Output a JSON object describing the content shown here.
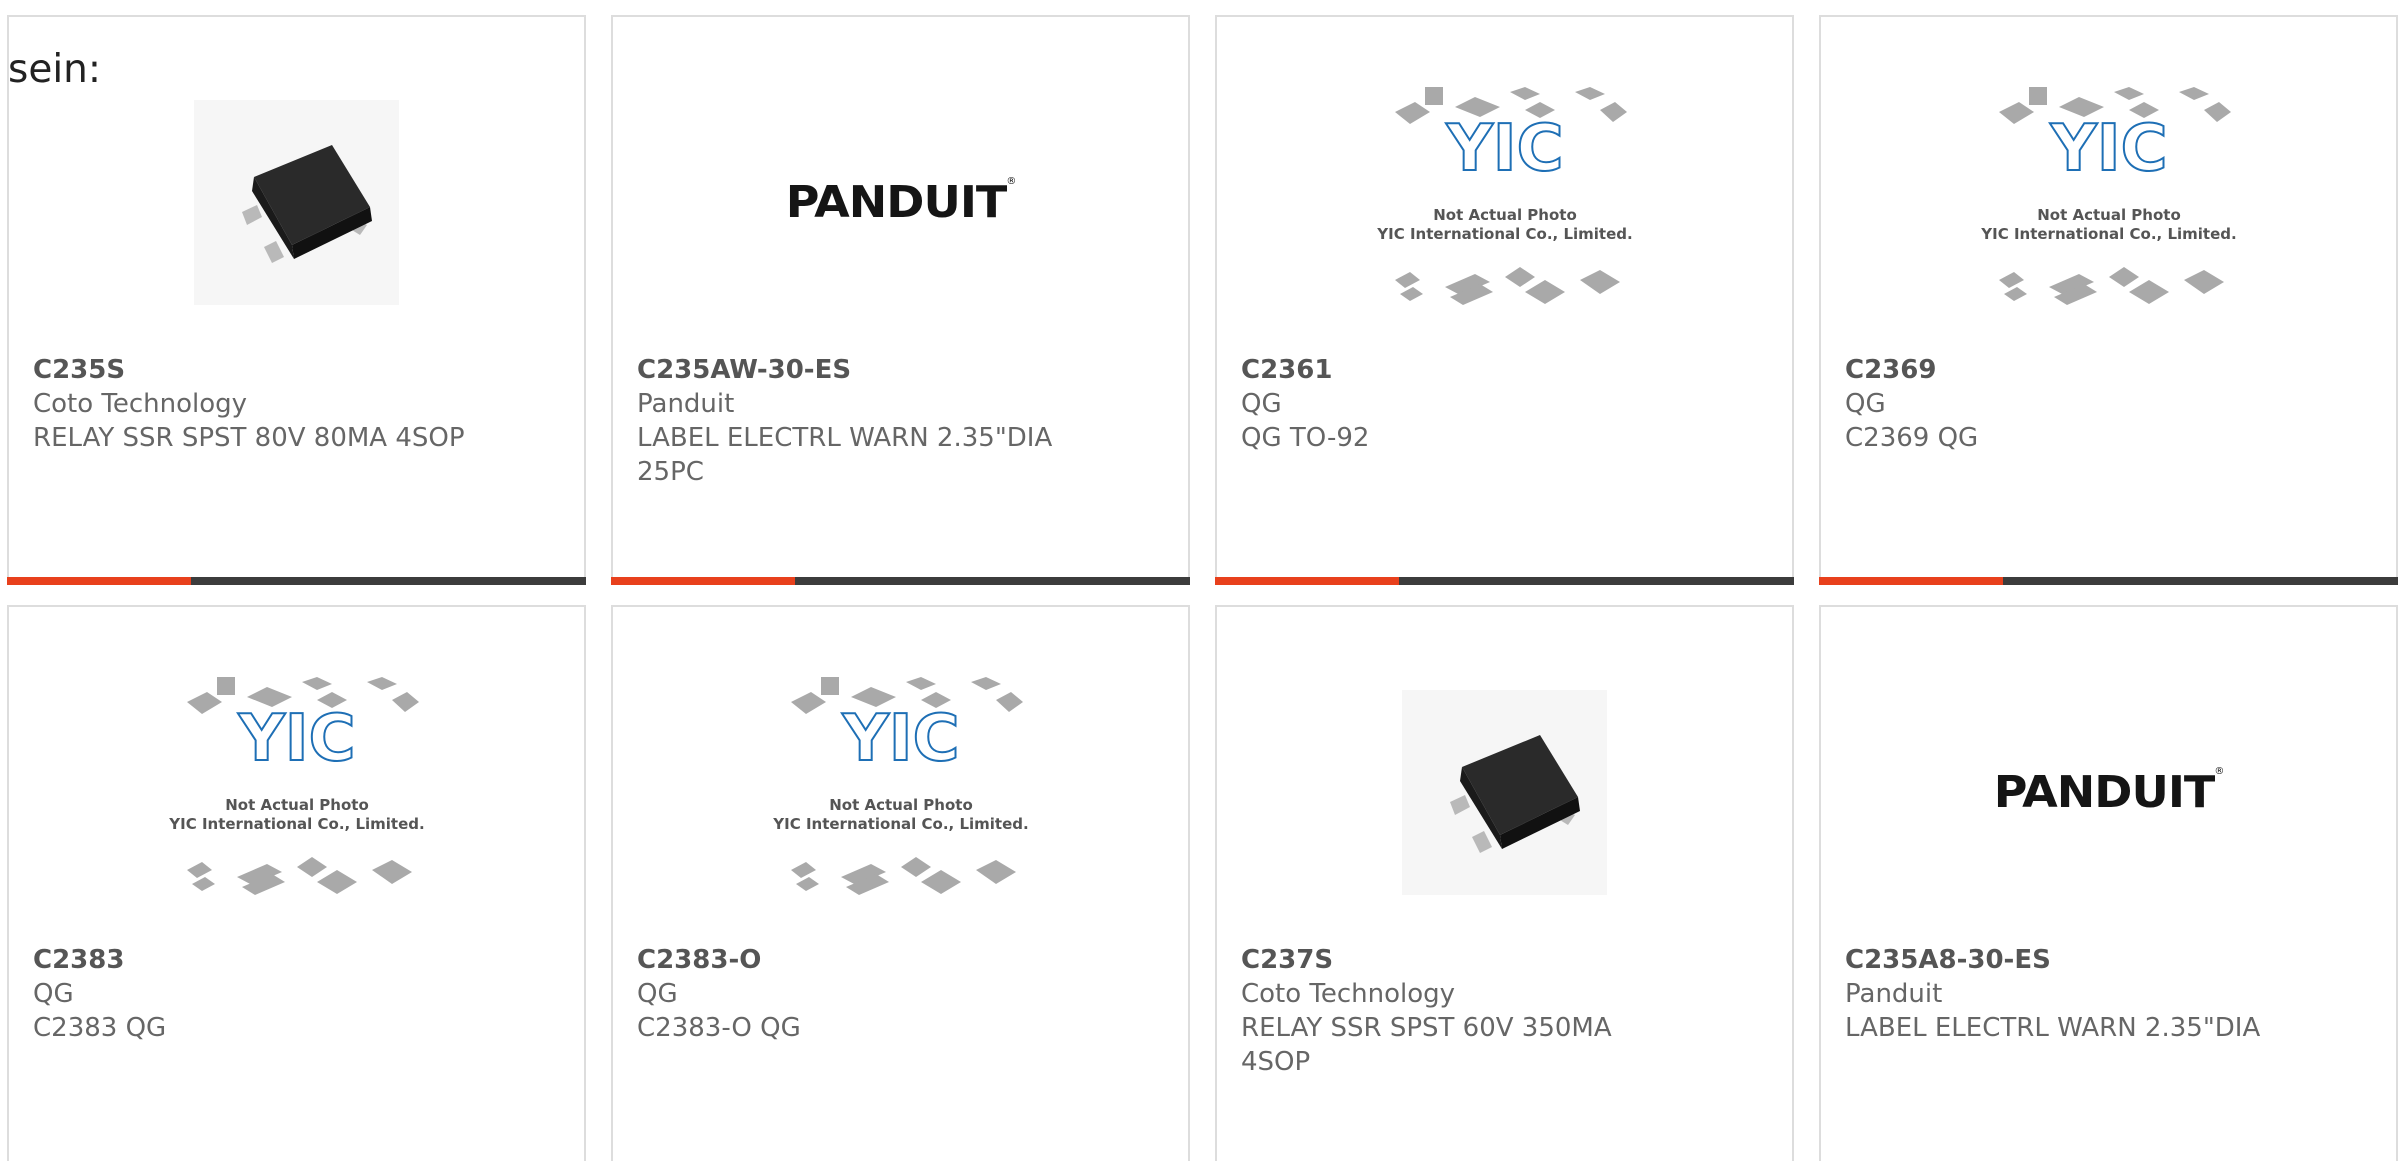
{
  "intro_text": "sein:",
  "colors": {
    "accent": "#e8401c",
    "bar_dark": "#3c3c3c",
    "card_border": "#dddddd",
    "text_gray": "#666666",
    "yic_blue": "#1e6fb5"
  },
  "yic_placeholder": {
    "brand": "YIC",
    "line1": "Not Actual Photo",
    "line2": "YIC International Co., Limited."
  },
  "products": [
    {
      "part_number": "C235S",
      "manufacturer": "Coto Technology",
      "description": "RELAY SSR SPST 80V 80MA 4SOP",
      "image": "relay-chip-photo"
    },
    {
      "part_number": "C235AW-30-ES",
      "manufacturer": "Panduit",
      "description": "LABEL ELECTRL WARN 2.35\"DIA 25PC",
      "image": "panduit-logo",
      "logo_text": "PANDUIT"
    },
    {
      "part_number": "C2361",
      "manufacturer": "QG",
      "description": "QG TO-92",
      "image": "yic-placeholder"
    },
    {
      "part_number": "C2369",
      "manufacturer": "QG",
      "description": "C2369 QG",
      "image": "yic-placeholder"
    },
    {
      "part_number": "C2383",
      "manufacturer": "QG",
      "description": "C2383 QG",
      "image": "yic-placeholder"
    },
    {
      "part_number": "C2383-O",
      "manufacturer": "QG",
      "description": "C2383-O QG",
      "image": "yic-placeholder"
    },
    {
      "part_number": "C237S",
      "manufacturer": "Coto Technology",
      "description": "RELAY SSR SPST 60V 350MA 4SOP",
      "image": "relay-chip-photo"
    },
    {
      "part_number": "C235A8-30-ES",
      "manufacturer": "Panduit",
      "description": "LABEL ELECTRL WARN 2.35\"DIA",
      "image": "panduit-logo",
      "logo_text": "PANDUIT"
    }
  ]
}
